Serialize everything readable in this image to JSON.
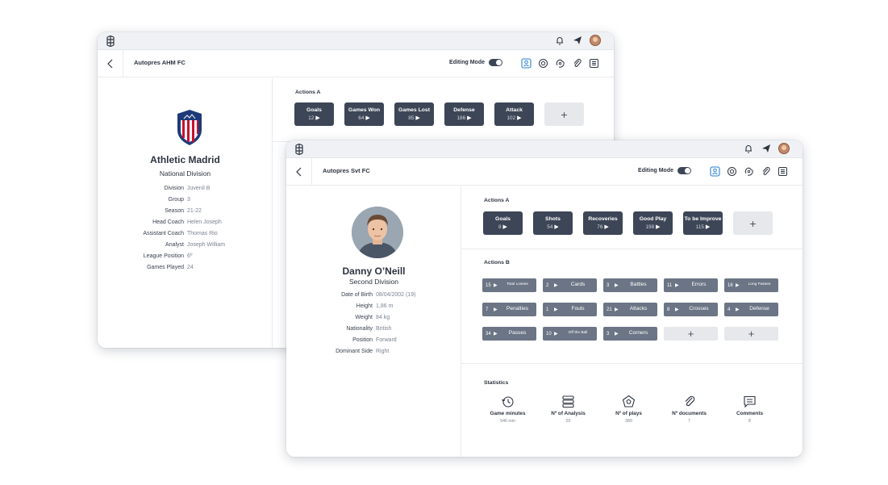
{
  "back_window": {
    "club_title": "Autopres AHM FC",
    "editing_mode_label": "Editing Mode",
    "team": {
      "name": "Athletic Madrid",
      "division": "National Division"
    },
    "info": [
      {
        "label": "Division",
        "value": "Juvenil B"
      },
      {
        "label": "Group",
        "value": "3"
      },
      {
        "label": "Season",
        "value": "21-22"
      },
      {
        "label": "Head Coach",
        "value": "Helen Joseph"
      },
      {
        "label": "Assistant Coach",
        "value": "Thomas Rio"
      },
      {
        "label": "Analyst",
        "value": "Joseph William"
      },
      {
        "label": "League Position",
        "value": "6º"
      },
      {
        "label": "Games Played",
        "value": "24"
      }
    ],
    "actions_a_title": "Actions A",
    "actions_a": [
      {
        "name": "Goals",
        "count": "12"
      },
      {
        "name": "Games Won",
        "count": "64"
      },
      {
        "name": "Games Lost",
        "count": "85"
      },
      {
        "name": "Defense",
        "count": "186"
      },
      {
        "name": "Attack",
        "count": "102"
      }
    ],
    "add_label": "+"
  },
  "front_window": {
    "club_title": "Autopres Svt FC",
    "editing_mode_label": "Editing Mode",
    "player": {
      "name": "Danny O’Neill",
      "division": "Second Division"
    },
    "info": [
      {
        "label": "Date of Birth",
        "value": "08/04/2002 (19)"
      },
      {
        "label": "Height",
        "value": "1,86 m"
      },
      {
        "label": "Weight",
        "value": "84 kg"
      },
      {
        "label": "Nationality",
        "value": "British"
      },
      {
        "label": "Position",
        "value": "Forward"
      },
      {
        "label": "Dominant Side",
        "value": "Right"
      }
    ],
    "actions_a_title": "Actions A",
    "actions_a": [
      {
        "name": "Goals",
        "count": "8"
      },
      {
        "name": "Shots",
        "count": "54"
      },
      {
        "name": "Recoveries",
        "count": "76"
      },
      {
        "name": "Good Play",
        "count": "198"
      },
      {
        "name": "To be Improve",
        "count": "115"
      }
    ],
    "actions_b_title": "Actions B",
    "actions_b": [
      {
        "count": "15",
        "name": "Total Losses",
        "small": true
      },
      {
        "count": "2",
        "name": "Cards"
      },
      {
        "count": "3",
        "name": "Battles"
      },
      {
        "count": "11",
        "name": "Errors"
      },
      {
        "count": "16",
        "name": "Long Passes",
        "small": true
      },
      {
        "count": "7",
        "name": "Penalties"
      },
      {
        "count": "1",
        "name": "Fouls"
      },
      {
        "count": "21",
        "name": "Attacks"
      },
      {
        "count": "8",
        "name": "Crosses"
      },
      {
        "count": "4",
        "name": "Defense"
      },
      {
        "count": "34",
        "name": "Passes"
      },
      {
        "count": "10",
        "name": "Off the Ball",
        "small": true
      },
      {
        "count": "3",
        "name": "Corners"
      }
    ],
    "add_label": "+",
    "statistics_title": "Statistics",
    "statistics": [
      {
        "label": "Game minutes",
        "value": "546 min",
        "icon": "history-clock-icon"
      },
      {
        "label": "Nº of Analysis",
        "value": "20",
        "icon": "analysis-stack-icon"
      },
      {
        "label": "Nº of plays",
        "value": "389",
        "icon": "pentagon-ball-icon"
      },
      {
        "label": "Nº documents",
        "value": "7",
        "icon": "paperclip-icon"
      },
      {
        "label": "Comments",
        "value": "8",
        "icon": "comment-icon"
      }
    ]
  },
  "colors": {
    "button_dark": "#3d4656",
    "button_mid": "#6b7585",
    "button_add": "#e6e8ec",
    "accent_blue": "#2a7fd4",
    "text": "#2d3440"
  }
}
